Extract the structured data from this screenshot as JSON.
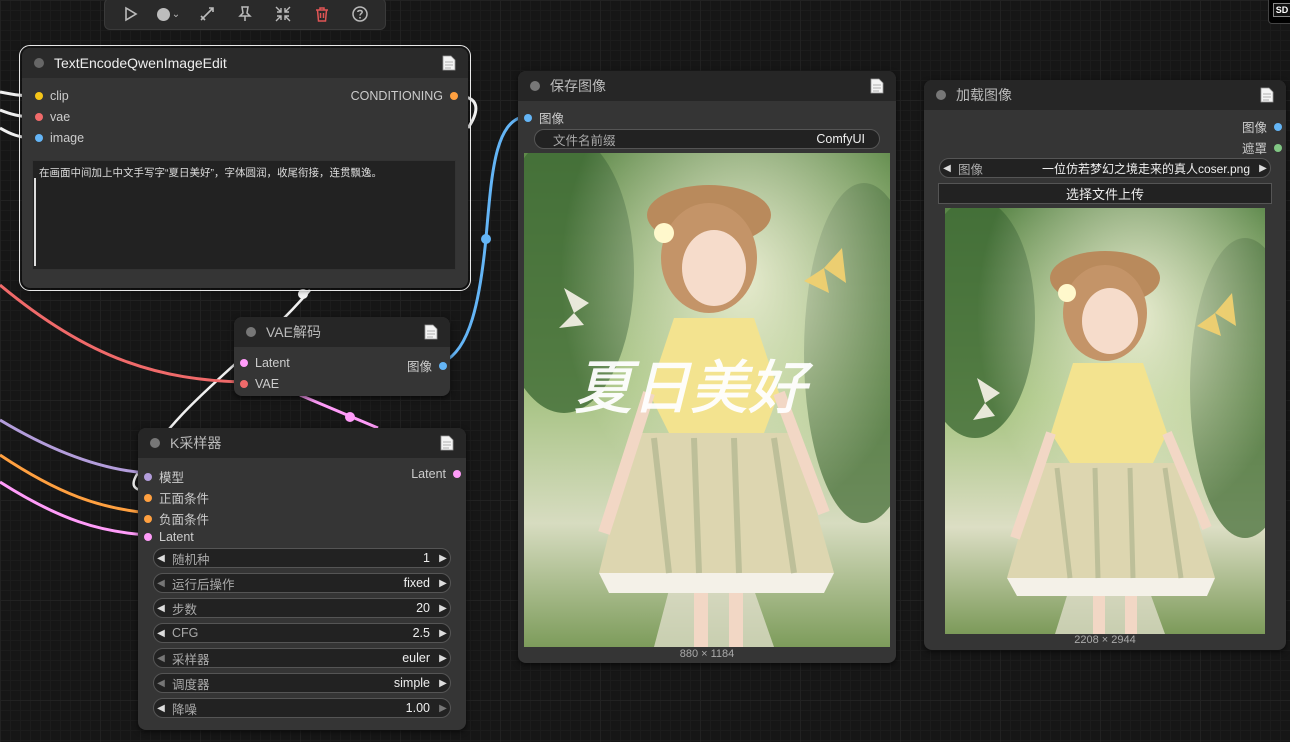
{
  "badge": {
    "label": "SD"
  },
  "text_encode_node": {
    "title": "TextEncodeQwenImageEdit",
    "inputs": [
      "clip",
      "vae",
      "image"
    ],
    "output": "CONDITIONING",
    "prompt": "在画面中间加上中文手写字“夏日美好”，字体圆润，收尾衔接，连贯飘逸。"
  },
  "save_node": {
    "title": "保存图像",
    "input": "图像",
    "prefix_label": "文件名前缀",
    "prefix_value": "ComfyUI",
    "overlay_text": "夏日美好",
    "image_size": "880 × 1184"
  },
  "load_node": {
    "title": "加载图像",
    "outputs": [
      "图像",
      "遮罩"
    ],
    "image_label": "图像",
    "image_value": "一位仿若梦幻之境走来的真人coser.png",
    "upload_label": "选择文件上传",
    "image_size": "2208 × 2944"
  },
  "vae_node": {
    "title": "VAE解码",
    "inputs": [
      "Latent",
      "VAE"
    ],
    "output": "图像"
  },
  "ksampler_node": {
    "title": "K采样器",
    "inputs": [
      "模型",
      "正面条件",
      "负面条件",
      "Latent"
    ],
    "output": "Latent",
    "widgets": [
      {
        "label": "随机种",
        "value": "1"
      },
      {
        "label": "运行后操作",
        "value": "fixed"
      },
      {
        "label": "步数",
        "value": "20"
      },
      {
        "label": "CFG",
        "value": "2.5"
      },
      {
        "label": "采样器",
        "value": "euler"
      },
      {
        "label": "调度器",
        "value": "simple"
      },
      {
        "label": "降噪",
        "value": "1.00"
      }
    ]
  },
  "colors": {
    "clip": "#f5c518",
    "vae": "#f06a6a",
    "image": "#64b5f6",
    "conditioning": "#ffa040",
    "latent": "#ff9cf9",
    "model": "#b39ddb",
    "mask": "#81c784"
  }
}
